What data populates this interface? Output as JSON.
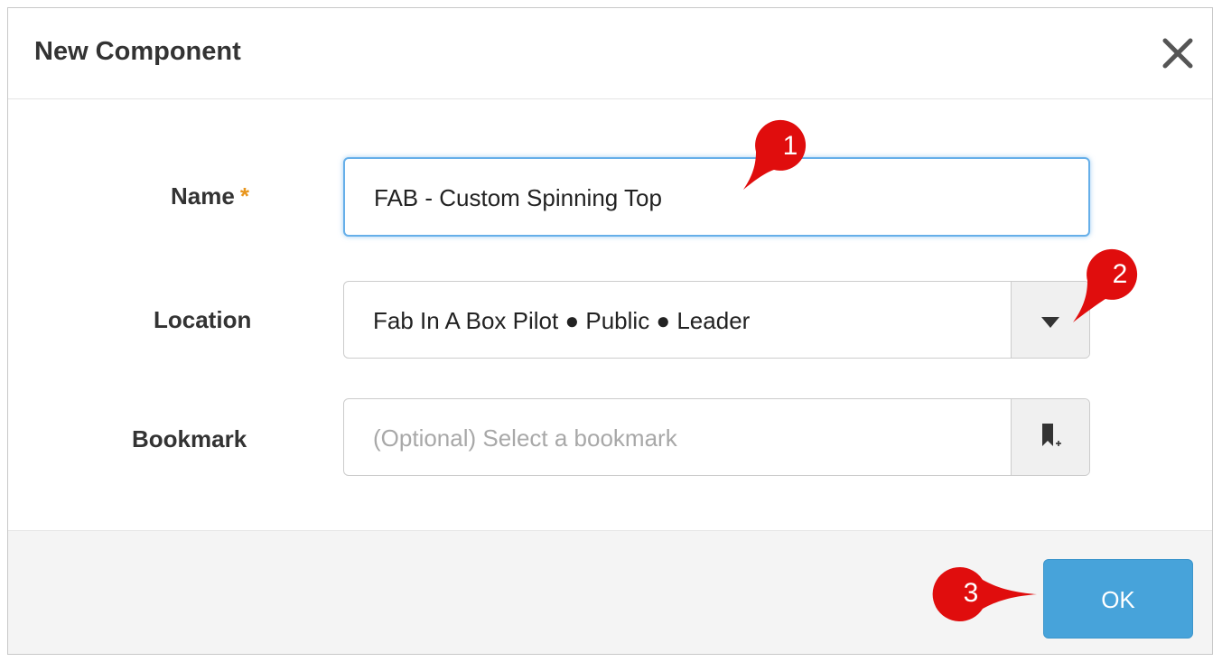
{
  "dialog": {
    "title": "New Component",
    "close_icon": "close-icon"
  },
  "form": {
    "name": {
      "label": "Name",
      "required_marker": "*",
      "value": "FAB - Custom Spinning Top"
    },
    "location": {
      "label": "Location",
      "value": "Fab In A Box Pilot ● Public ● Leader",
      "icon": "caret-down-icon"
    },
    "bookmark": {
      "label": "Bookmark",
      "placeholder": "(Optional) Select a bookmark",
      "icon": "bookmark-add-icon"
    }
  },
  "footer": {
    "ok_label": "OK"
  },
  "callouts": [
    "1",
    "2",
    "3"
  ],
  "colors": {
    "primary_button": "#47a3da",
    "focus_border": "#66afe9",
    "required": "#e8961e",
    "callout": "#e00d0d"
  }
}
